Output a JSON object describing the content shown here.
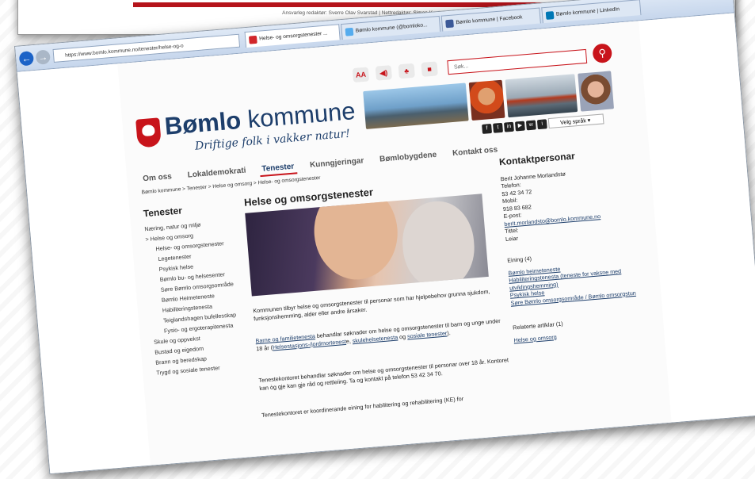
{
  "back_window": {
    "footer_text": "Ansvarleg redaktør: Sverre Olav Svarstad | Nettredaktør:",
    "footer_link": "Simon Knutsson Sortland"
  },
  "browser": {
    "address": "https://www.bomlo.kommune.no/tenester/helse-og-o",
    "tabs": [
      {
        "label": "Helse- og omsorgstenester ...",
        "active": true,
        "icon_color": "#d1262b"
      },
      {
        "label": "Bømlo kommune (@bomloko...",
        "active": false,
        "icon_color": "#55acee"
      },
      {
        "label": "Bømlo kommune | Facebook",
        "active": false,
        "icon_color": "#3b5998"
      },
      {
        "label": "Bømlo kommune | LinkedIn",
        "active": false,
        "icon_color": "#0077b5"
      }
    ]
  },
  "site": {
    "brand_bold": "Bømlo",
    "brand_rest": "kommune",
    "tagline": "Driftige folk i vakker natur!",
    "search_placeholder": "Søk...",
    "language": "Velg språk",
    "top_icons": [
      "AA",
      "◀)",
      "♣",
      "■"
    ],
    "social": [
      "f",
      "t",
      "in",
      "▶",
      "w",
      "i"
    ],
    "menu": [
      "Om oss",
      "Lokaldemokrati",
      "Tenester",
      "Kunngjeringar",
      "Bømlobygdene",
      "Kontakt oss"
    ],
    "active_menu": "Tenester",
    "breadcrumb": "Bømlo kommune >   Tenester >   Helse og omsorg >   Helse- og omsorgstenester"
  },
  "sidebar": {
    "title": "Tenester",
    "items": [
      "Næring, natur og miljø",
      "> Helse og omsorg",
      "Helse- og omsorgstenester",
      "Legetenester",
      "Psykisk helse",
      "Bømlo bu- og helsesenter",
      "Søre Bømlo omsorgsområde",
      "Bømlo Heimeteneste",
      "Habiliteringstenesta",
      "Teiglandshagen bufellesskap",
      "Fysio- og ergoterapitenesta",
      "Skule og oppvekst",
      "Bustad og eigedom",
      "Brann og beredskap",
      "Trygd og sosiale tenester"
    ]
  },
  "main": {
    "title": "Helse og omsorgstenester",
    "intro": "Kommunen tilbyr helse og omsorgstenester til personar som har hjelpebehov grunna sjukdom, funksjonshemming, alder eller andre årsaker.",
    "p2_link": "Barne og familietenesta",
    "p2_text": " behandlar søknader om helse og omsorgstenester til barn og unge under 18 år (",
    "p2_link2": "Helsestasjons-/jordmortenest",
    "p2_text2": "e, ",
    "p2_link3": "skulehelsetenesta",
    "p2_text3": " og ",
    "p2_link4": "sosiale tenester",
    "p2_end": ").",
    "p3": "Tenestekontoret behandlar søknader om helse og omsorgstenester til personar over 18 år. Kontoret kan òg gje kan gje råd og rettleiing. Ta og kontakt på telefon 53 42 34 70.",
    "p4": "Tenestekontoret er koordinerande eining for habilitering og rehabilitering (KE) for"
  },
  "contacts": {
    "title": "Kontaktpersonar",
    "name": "Berit Johanne Morlandstø",
    "phone_label": "Telefon:",
    "phone": "53 42 34 72",
    "mobile_label": "Mobil:",
    "mobile": "918 83 682",
    "email_label": "E-post:",
    "email": "berit.morlandsto@bomlo.kommune.no",
    "title_label": "Tittel:",
    "role": "Leiar",
    "units_heading": "Eining (4)",
    "units": [
      "Bømlo heimeteneste",
      "Habiliteringstenesta (teneste for vaksne med utviklingshemming)",
      "Psykisk helse",
      "Søre Bømlo omsorgsområde / Bømlo omsorgstun"
    ],
    "related_heading": "Relaterte artiklar (1)",
    "related": [
      "Helse og omsorg"
    ]
  }
}
